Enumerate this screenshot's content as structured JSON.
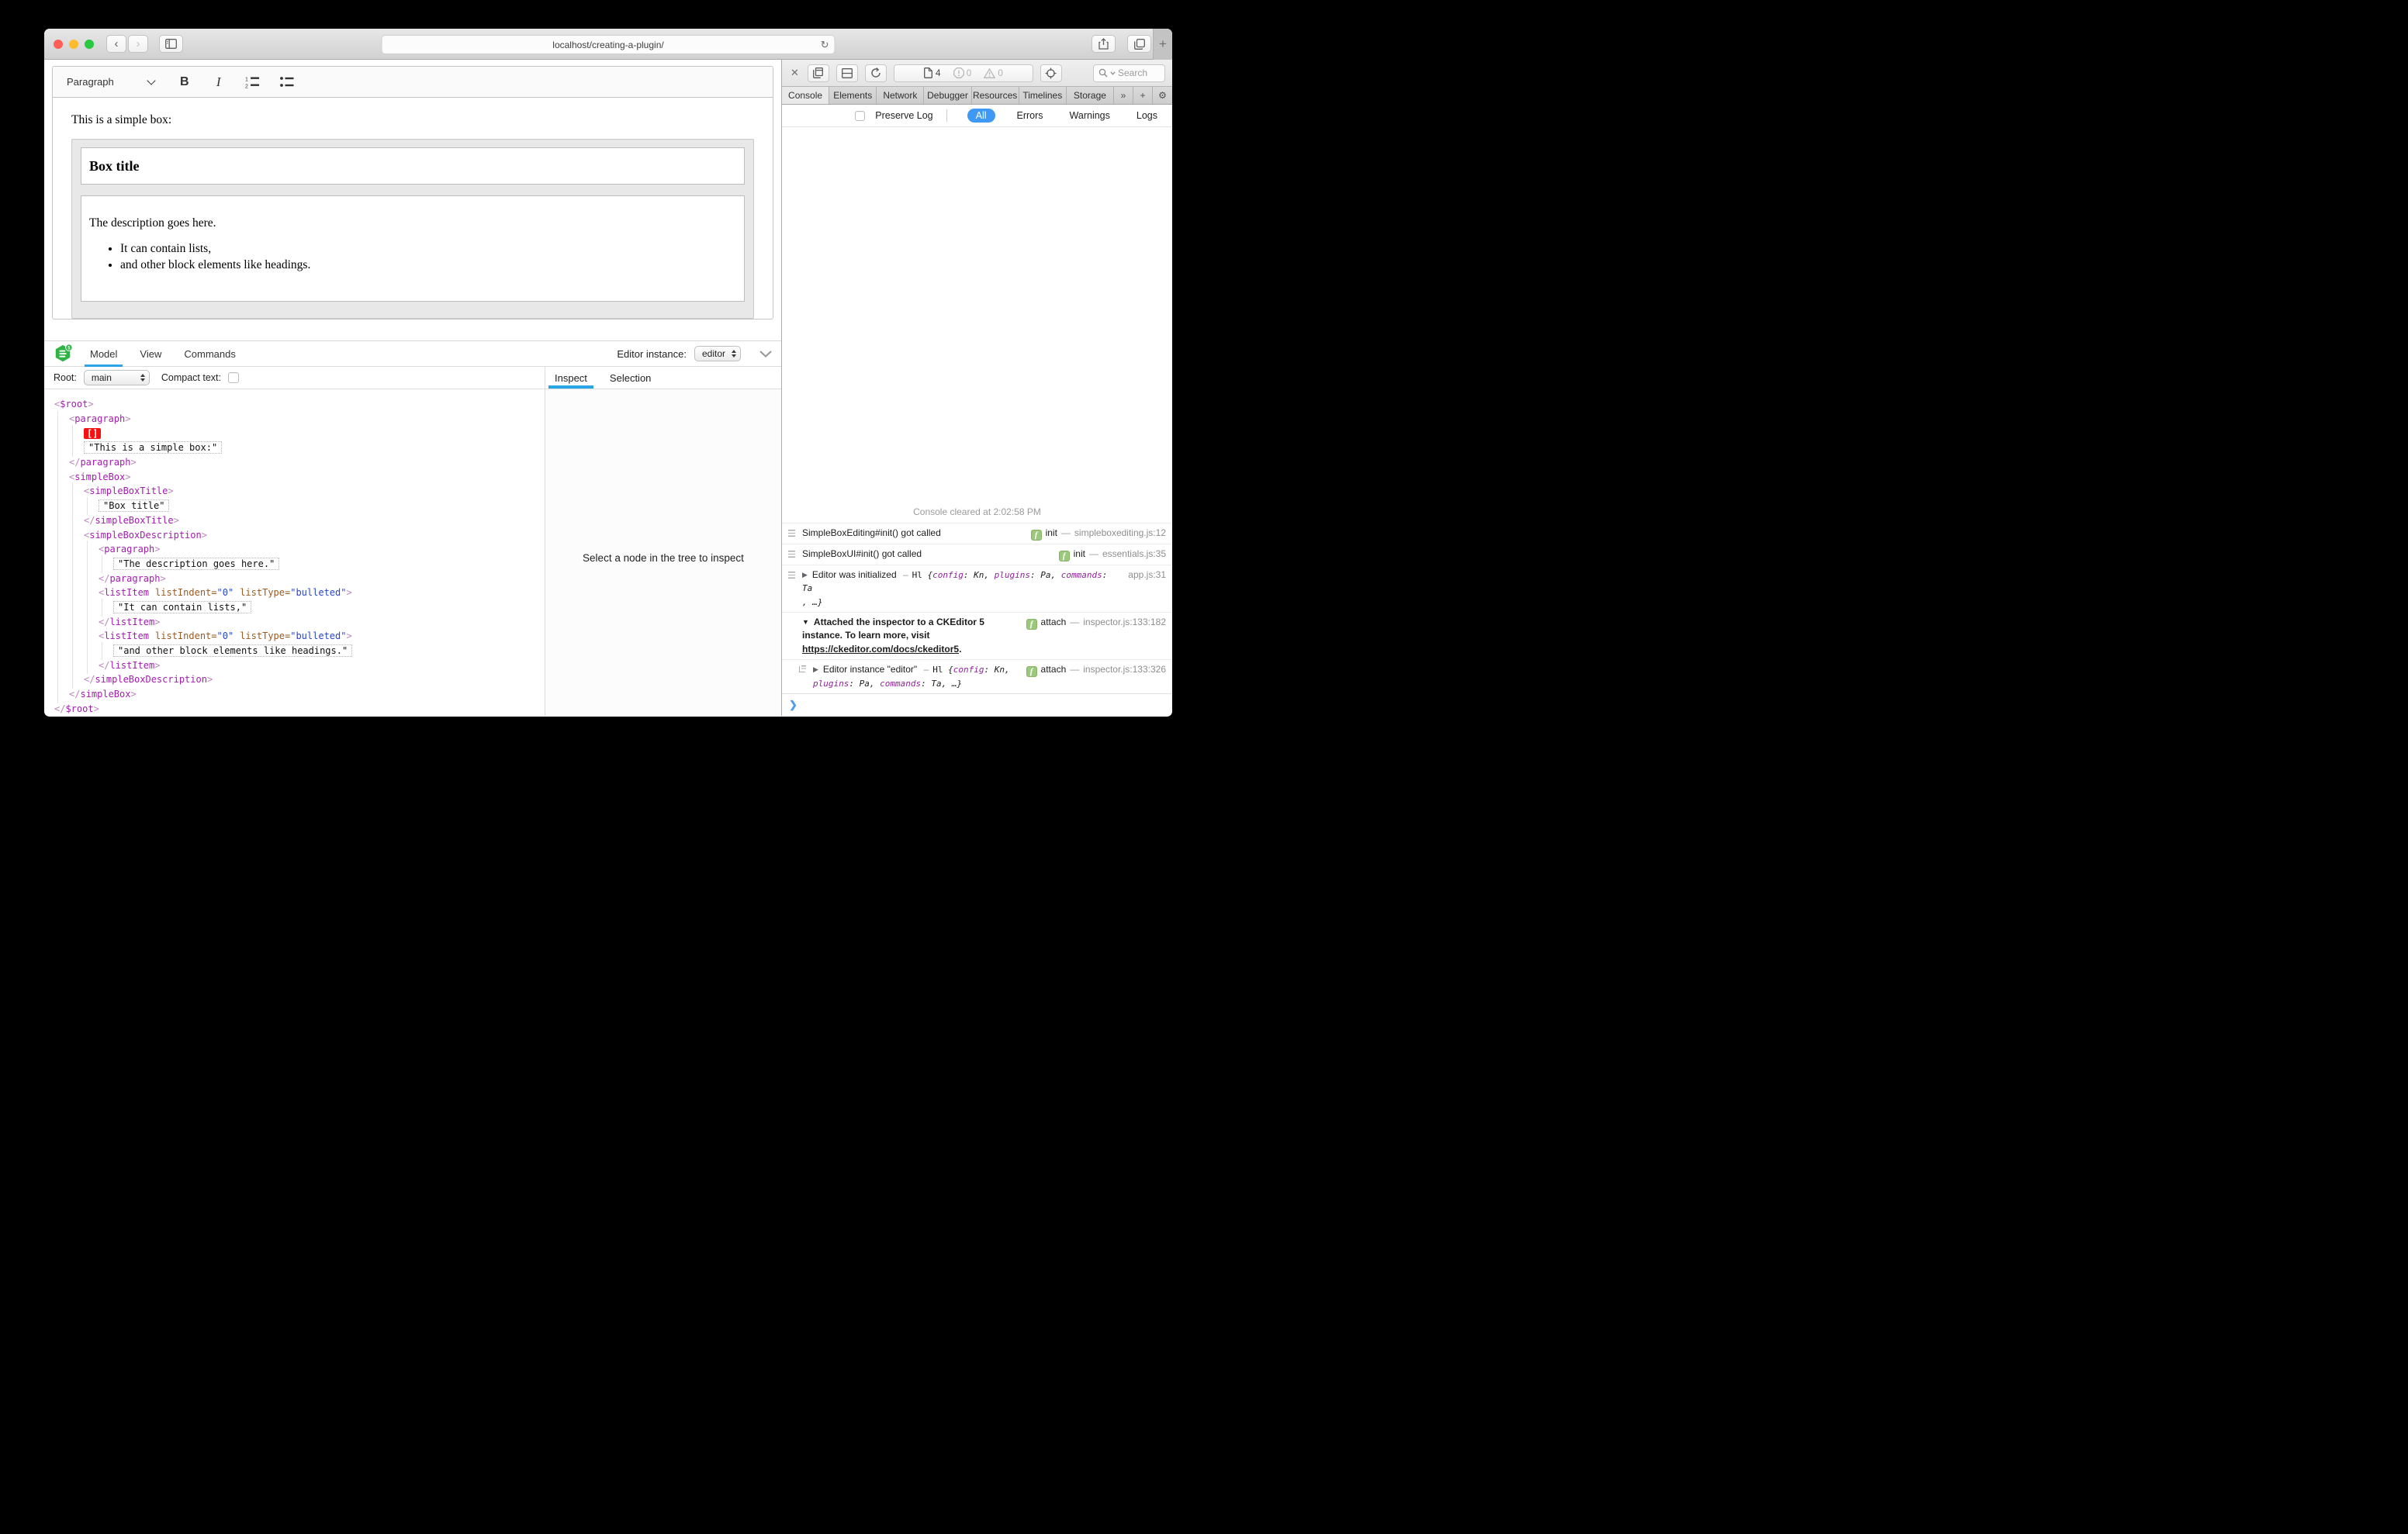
{
  "colors": {
    "accent": "#3d99f4",
    "inspBlue": "#2aa5e6",
    "selRed": "#f31212",
    "logoGreen": "#2fb344",
    "badgeGreen": "#9cc87c",
    "tag": "#a21caf",
    "attr": "#9a5a21",
    "val": "#2846cc",
    "objKey": "#91219b"
  },
  "titlebar": {
    "url": "localhost/creating-a-plugin/",
    "reload": "↻",
    "back": "‹",
    "forward": "›",
    "new_tab": "+"
  },
  "editor": {
    "toolbar": {
      "style": "Paragraph",
      "bold": "B",
      "italic": "I"
    },
    "intro": "This is a simple box:",
    "box": {
      "title": "Box title",
      "description": "The description goes here.",
      "bullets": [
        {
          "t": "It can contain lists,"
        },
        {
          "t": "and other block elements like headings."
        }
      ]
    }
  },
  "inspector": {
    "tabs": [
      {
        "label": "Model",
        "active": true
      },
      {
        "label": "View"
      },
      {
        "label": "Commands"
      }
    ],
    "instance_label": "Editor instance:",
    "instance": "editor",
    "root_label": "Root:",
    "root": "main",
    "compact_label": "Compact text:",
    "pane_tabs": [
      {
        "label": "Inspect",
        "active": true
      },
      {
        "label": "Selection"
      }
    ],
    "empty": "Select a node in the tree to inspect",
    "tree": [
      {
        "indent": 0,
        "segs": [
          {
            "c": "br",
            "t": "<"
          },
          {
            "c": "tag",
            "t": "$root"
          },
          {
            "c": "br",
            "t": ">"
          }
        ]
      },
      {
        "indent": 1,
        "segs": [
          {
            "c": "br",
            "t": "<"
          },
          {
            "c": "tag",
            "t": "paragraph"
          },
          {
            "c": "br",
            "t": ">"
          }
        ]
      },
      {
        "indent": 2,
        "segs": [
          {
            "c": "sel",
            "t": "[]"
          }
        ]
      },
      {
        "indent": 2,
        "segs": [
          {
            "c": "str",
            "t": "\"This is a simple box:\""
          }
        ]
      },
      {
        "indent": 1,
        "segs": [
          {
            "c": "br",
            "t": "</"
          },
          {
            "c": "tag",
            "t": "paragraph"
          },
          {
            "c": "br",
            "t": ">"
          }
        ]
      },
      {
        "indent": 1,
        "segs": [
          {
            "c": "br",
            "t": "<"
          },
          {
            "c": "tag",
            "t": "simpleBox"
          },
          {
            "c": "br",
            "t": ">"
          }
        ]
      },
      {
        "indent": 2,
        "segs": [
          {
            "c": "br",
            "t": "<"
          },
          {
            "c": "tag",
            "t": "simpleBoxTitle"
          },
          {
            "c": "br",
            "t": ">"
          }
        ]
      },
      {
        "indent": 3,
        "segs": [
          {
            "c": "str",
            "t": "\"Box title\""
          }
        ]
      },
      {
        "indent": 2,
        "segs": [
          {
            "c": "br",
            "t": "</"
          },
          {
            "c": "tag",
            "t": "simpleBoxTitle"
          },
          {
            "c": "br",
            "t": ">"
          }
        ]
      },
      {
        "indent": 2,
        "segs": [
          {
            "c": "br",
            "t": "<"
          },
          {
            "c": "tag",
            "t": "simpleBoxDescription"
          },
          {
            "c": "br",
            "t": ">"
          }
        ]
      },
      {
        "indent": 3,
        "segs": [
          {
            "c": "br",
            "t": "<"
          },
          {
            "c": "tag",
            "t": "paragraph"
          },
          {
            "c": "br",
            "t": ">"
          }
        ]
      },
      {
        "indent": 4,
        "segs": [
          {
            "c": "str",
            "t": "\"The description goes here.\""
          }
        ]
      },
      {
        "indent": 3,
        "segs": [
          {
            "c": "br",
            "t": "</"
          },
          {
            "c": "tag",
            "t": "paragraph"
          },
          {
            "c": "br",
            "t": ">"
          }
        ]
      },
      {
        "indent": 3,
        "segs": [
          {
            "c": "br",
            "t": "<"
          },
          {
            "c": "tag",
            "t": "listItem"
          },
          {
            "c": "attr",
            "t": "listIndent"
          },
          {
            "c": "eq",
            "t": "="
          },
          {
            "c": "val",
            "t": "\"0\""
          },
          {
            "c": "attr",
            "t": "listType"
          },
          {
            "c": "eq",
            "t": "="
          },
          {
            "c": "val",
            "t": "\"bulleted\""
          },
          {
            "c": "br",
            "t": ">"
          }
        ]
      },
      {
        "indent": 4,
        "segs": [
          {
            "c": "str",
            "t": "\"It can contain lists,\""
          }
        ]
      },
      {
        "indent": 3,
        "segs": [
          {
            "c": "br",
            "t": "</"
          },
          {
            "c": "tag",
            "t": "listItem"
          },
          {
            "c": "br",
            "t": ">"
          }
        ]
      },
      {
        "indent": 3,
        "segs": [
          {
            "c": "br",
            "t": "<"
          },
          {
            "c": "tag",
            "t": "listItem"
          },
          {
            "c": "attr",
            "t": "listIndent"
          },
          {
            "c": "eq",
            "t": "="
          },
          {
            "c": "val",
            "t": "\"0\""
          },
          {
            "c": "attr",
            "t": "listType"
          },
          {
            "c": "eq",
            "t": "="
          },
          {
            "c": "val",
            "t": "\"bulleted\""
          },
          {
            "c": "br",
            "t": ">"
          }
        ]
      },
      {
        "indent": 4,
        "segs": [
          {
            "c": "str",
            "t": "\"and other block elements like headings.\""
          }
        ]
      },
      {
        "indent": 3,
        "segs": [
          {
            "c": "br",
            "t": "</"
          },
          {
            "c": "tag",
            "t": "listItem"
          },
          {
            "c": "br",
            "t": ">"
          }
        ]
      },
      {
        "indent": 2,
        "segs": [
          {
            "c": "br",
            "t": "</"
          },
          {
            "c": "tag",
            "t": "simpleBoxDescription"
          },
          {
            "c": "br",
            "t": ">"
          }
        ]
      },
      {
        "indent": 1,
        "segs": [
          {
            "c": "br",
            "t": "</"
          },
          {
            "c": "tag",
            "t": "simpleBox"
          },
          {
            "c": "br",
            "t": ">"
          }
        ]
      },
      {
        "indent": 0,
        "segs": [
          {
            "c": "br",
            "t": "</"
          },
          {
            "c": "tag",
            "t": "$root"
          },
          {
            "c": "br",
            "t": ">"
          }
        ]
      }
    ]
  },
  "devtools": {
    "toolbar": {
      "close": "✕",
      "pages": "4",
      "errors": "0",
      "warnings": "0",
      "search": "Search"
    },
    "tabs": [
      {
        "label": "Console",
        "active": true
      },
      {
        "label": "Elements"
      },
      {
        "label": "Network"
      },
      {
        "label": "Debugger"
      },
      {
        "label": "Resources"
      },
      {
        "label": "Timelines"
      },
      {
        "label": "Storage"
      }
    ],
    "tabs_more": "»",
    "tabs_add": "+",
    "gear": "⚙",
    "filter": {
      "preserve": "Preserve Log",
      "scopes": [
        {
          "label": "All",
          "active": true
        },
        {
          "label": "Errors"
        },
        {
          "label": "Warnings"
        },
        {
          "label": "Logs"
        }
      ]
    },
    "cleared": "Console cleared at 2:02:58 PM",
    "badge_letter": "f",
    "syntax": {
      "colon": ": ",
      "comma": ", ",
      "dash": "–",
      "sep": "—",
      "brace": "{",
      "ellipsis_close": ", …}"
    },
    "logs": {
      "r1": {
        "msg": "SimpleBoxEditing#init() got called",
        "fn": "init",
        "loc": "simpleboxediting.js:12"
      },
      "r2": {
        "msg": "SimpleBoxUI#init() got called",
        "fn": "init",
        "loc": "essentials.js:35"
      },
      "r3": {
        "arrow": "▶",
        "msg": "Editor was initialized",
        "cls": "Hl ",
        "k1": "config",
        "v1": "Kn",
        "k2": "plugins",
        "v2": "Pa",
        "k3": "commands",
        "v3": "Ta",
        "loc": "app.js:31"
      },
      "r4": {
        "arrow": "▼",
        "line1": "Attached the inspector to a CKEditor 5",
        "line2": "instance. To learn more, visit",
        "link": "https://ckeditor.com/docs/ckeditor5",
        "period": ".",
        "fn": "attach",
        "loc": "inspector.js:133:182"
      },
      "r5": {
        "arrow": "▶",
        "pre": "Editor instance \"editor\"",
        "cls": "Hl ",
        "k1": "config",
        "v1": "Kn",
        "k2": "plugins",
        "v2": "Pa",
        "k3": "commands",
        "v3": "Ta",
        "fn": "attach",
        "loc": "inspector.js:133:326"
      }
    },
    "prompt": "❯"
  }
}
